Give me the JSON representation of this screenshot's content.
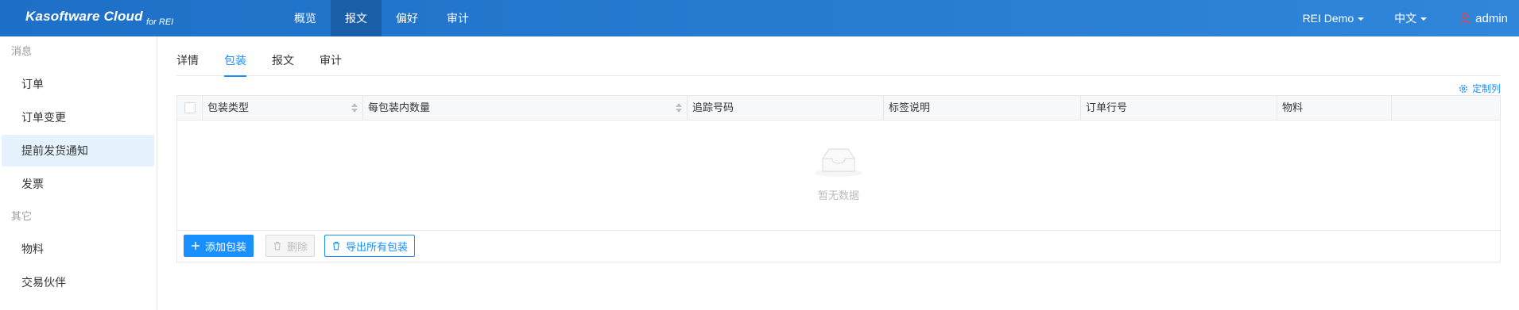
{
  "app": {
    "brand": "Kasoftware Cloud",
    "brand_sub": "for REI"
  },
  "nav": [
    {
      "label": "概览",
      "active": false
    },
    {
      "label": "报文",
      "active": true
    },
    {
      "label": "偏好",
      "active": false
    },
    {
      "label": "审计",
      "active": false
    }
  ],
  "topright": {
    "org": "REI Demo",
    "language": "中文",
    "user": "admin",
    "user_icon": "user-icon",
    "user_icon_color": "#e0464b"
  },
  "sidebar": {
    "groups": [
      {
        "label": "消息",
        "items": [
          {
            "label": "订单",
            "active": false
          },
          {
            "label": "订单变更",
            "active": false
          },
          {
            "label": "提前发货通知",
            "active": true
          },
          {
            "label": "发票",
            "active": false
          }
        ]
      },
      {
        "label": "其它",
        "items": [
          {
            "label": "物料",
            "active": false
          },
          {
            "label": "交易伙伴",
            "active": false
          }
        ]
      }
    ]
  },
  "tabs": [
    {
      "label": "详情",
      "active": false
    },
    {
      "label": "包装",
      "active": true
    },
    {
      "label": "报文",
      "active": false
    },
    {
      "label": "审计",
      "active": false
    }
  ],
  "table": {
    "customize_label": "定制列",
    "columns": [
      {
        "label": "包装类型",
        "sortable": true
      },
      {
        "label": "每包装内数量",
        "sortable": true
      },
      {
        "label": "追踪号码",
        "sortable": false
      },
      {
        "label": "标签说明",
        "sortable": false
      },
      {
        "label": "订单行号",
        "sortable": false
      },
      {
        "label": "物料",
        "sortable": false
      },
      {
        "label": "",
        "sortable": false
      }
    ],
    "rows": [],
    "empty_text": "暂无数据"
  },
  "actions": {
    "add": "添加包装",
    "delete": "删除",
    "export": "导出所有包装"
  },
  "colors": {
    "accent": "#1890ff",
    "topbar": "#2f82d6",
    "nav_active": "#1a5ea8",
    "sidebar_active": "#e6f3ff"
  }
}
